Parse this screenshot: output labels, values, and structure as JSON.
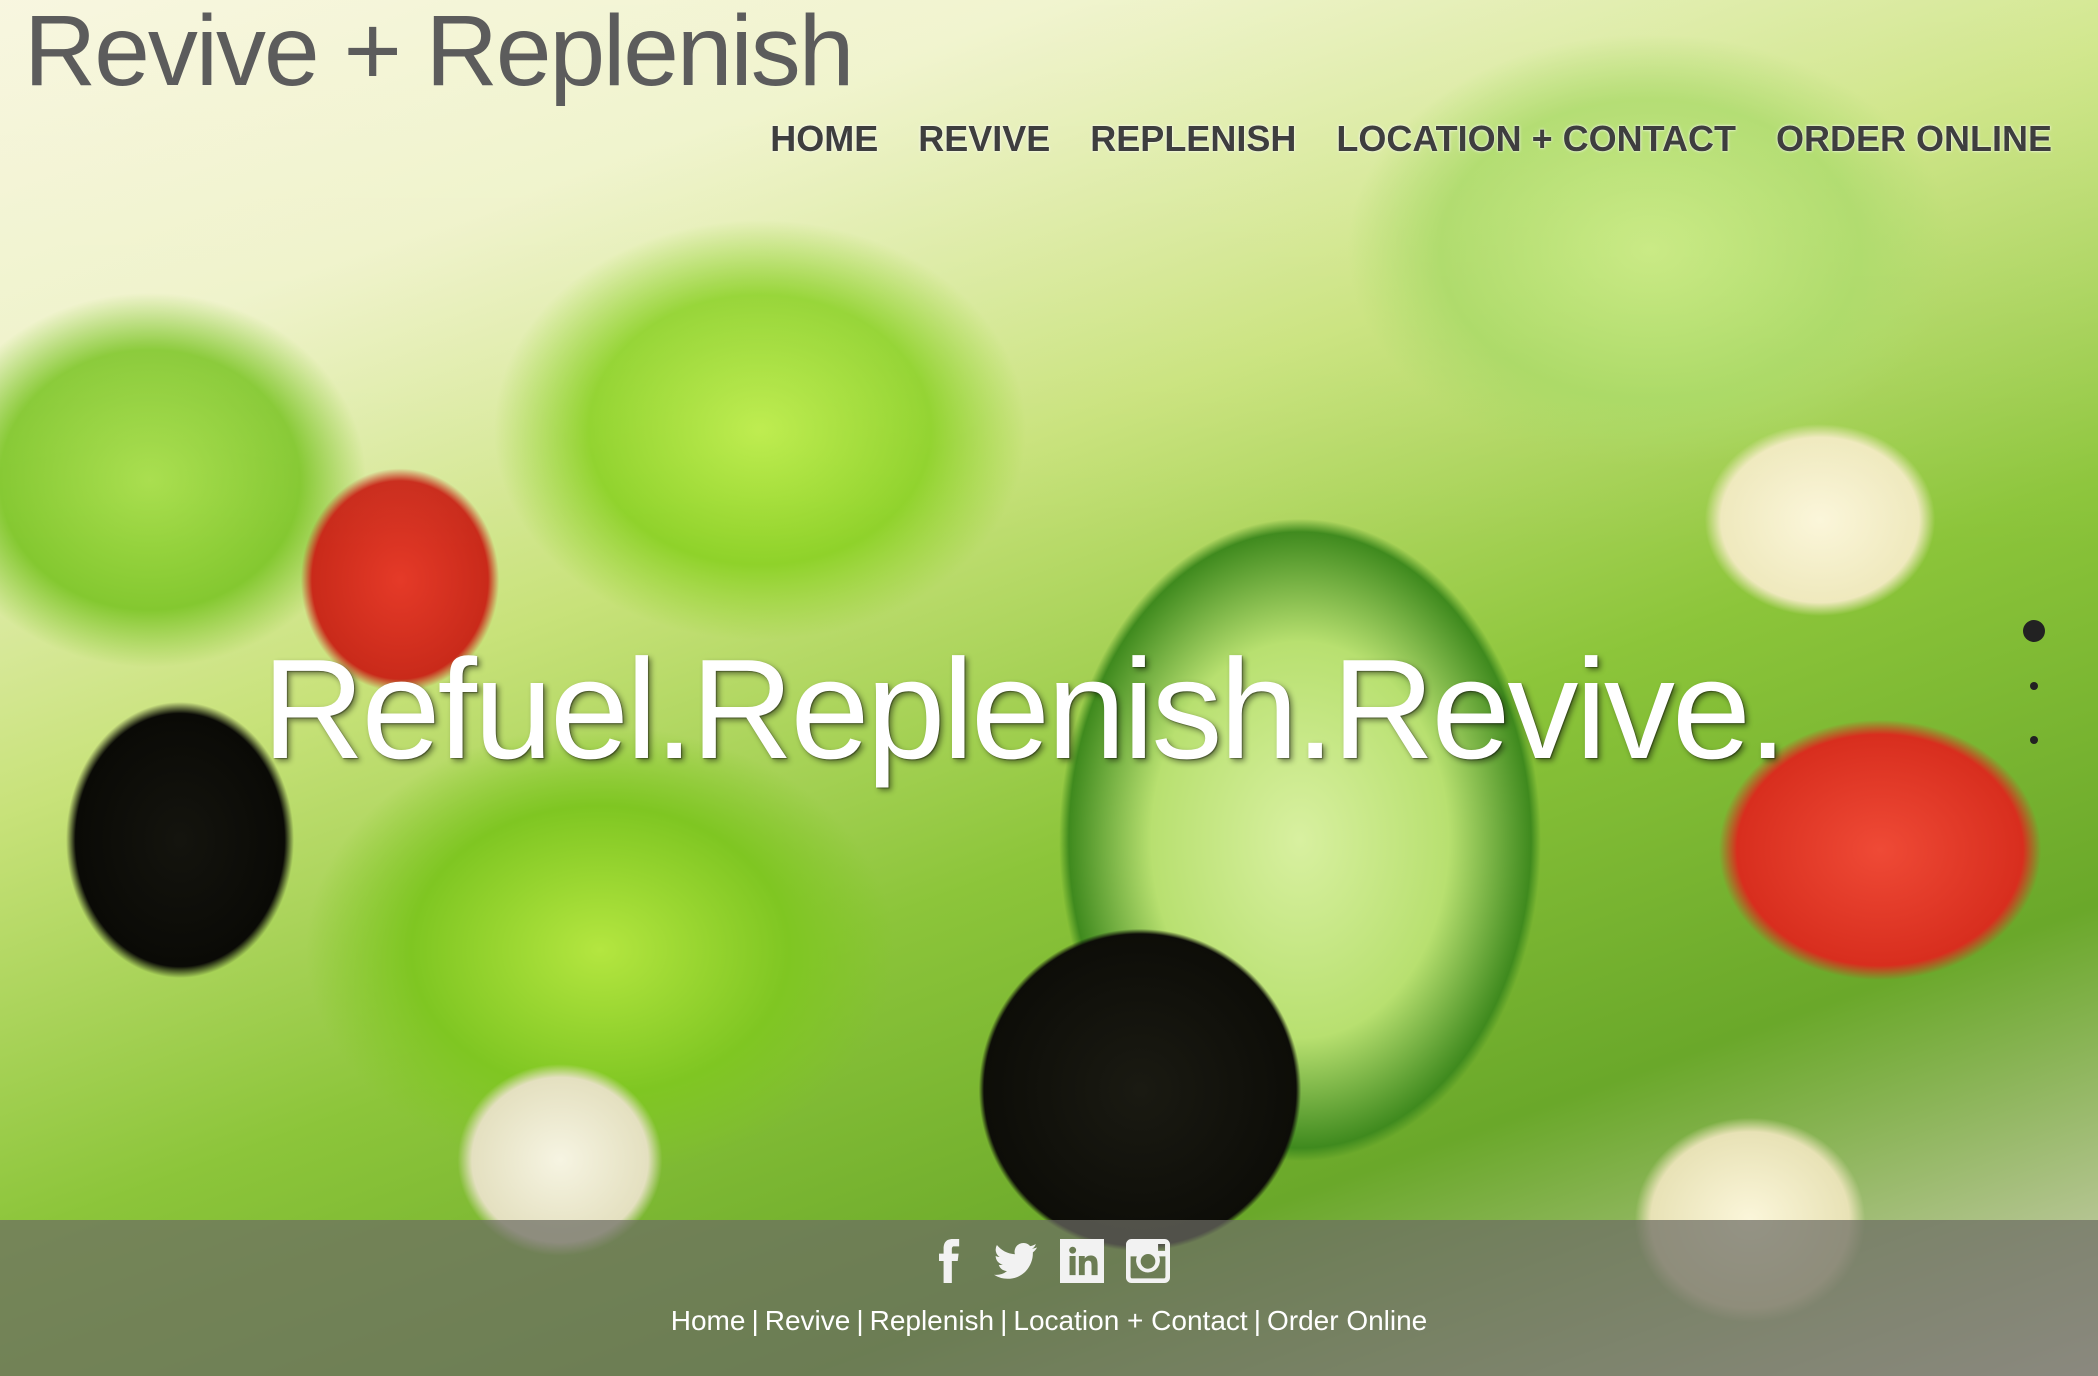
{
  "site": {
    "logo_text": "Revive + Replenish"
  },
  "nav": {
    "items": [
      {
        "label": "HOME"
      },
      {
        "label": "REVIVE"
      },
      {
        "label": "REPLENISH"
      },
      {
        "label": "LOCATION + CONTACT"
      },
      {
        "label": "ORDER ONLINE"
      }
    ]
  },
  "hero": {
    "headline": "Refuel.Replenish.Revive.",
    "slider": {
      "total_slides": 3,
      "active_slide": 1
    }
  },
  "footer": {
    "social_icons": [
      "facebook-icon",
      "twitter-icon",
      "linkedin-icon",
      "instagram-icon"
    ],
    "links": [
      {
        "label": "Home"
      },
      {
        "label": "Revive"
      },
      {
        "label": "Replenish"
      },
      {
        "label": "Location + Contact"
      },
      {
        "label": "Order Online"
      }
    ],
    "separator": "|"
  },
  "colors": {
    "logo": "#5c5c5c",
    "nav_text": "#3e3e3e",
    "headline": "#ffffff",
    "footer_bar": "#6c6c64"
  }
}
